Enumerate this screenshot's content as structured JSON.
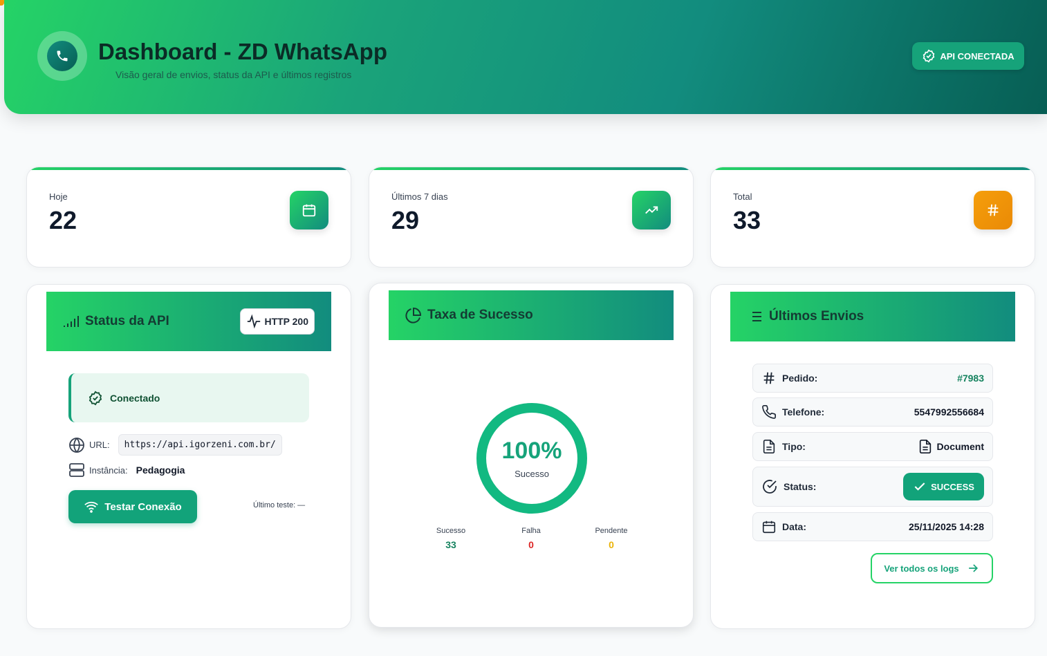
{
  "header": {
    "title": "Dashboard - ZD WhatsApp",
    "subtitle": "Visão geral de envios, status da API e últimos registros",
    "api_status_label": "API CONECTADA"
  },
  "stats": [
    {
      "label": "Hoje",
      "value": "22",
      "icon": "calendar-icon"
    },
    {
      "label": "Últimos 7 dias",
      "value": "29",
      "icon": "trending-up-icon"
    },
    {
      "label": "Total",
      "value": "33",
      "icon": "hash-icon"
    }
  ],
  "api_panel": {
    "title": "Status da API",
    "http_badge": "HTTP 200",
    "connection_status": "Conectado",
    "url_label": "URL:",
    "url_value": "https://api.igorzeni.com.br/",
    "instance_label": "Instância:",
    "instance_value": "Pedagogia",
    "test_button": "Testar Conexão",
    "last_test": "Último teste: —"
  },
  "success_panel": {
    "title": "Taxa de Sucesso",
    "percent_label": "100%",
    "percent_value": 100,
    "caption": "Sucesso",
    "legend": [
      {
        "label": "Sucesso",
        "value": "33",
        "color": "#16a37a"
      },
      {
        "label": "Falha",
        "value": "0",
        "color": "#dc2626"
      },
      {
        "label": "Pendente",
        "value": "0",
        "color": "#eab308"
      }
    ]
  },
  "last_sends": {
    "title": "Últimos Envios",
    "rows": [
      {
        "label": "Pedido:",
        "value": "#7983",
        "icon": "hash-icon"
      },
      {
        "label": "Telefone:",
        "value": "5547992556684",
        "icon": "phone-icon"
      },
      {
        "label": "Tipo:",
        "value": "Document",
        "icon": "document-icon"
      },
      {
        "label": "Status:",
        "value": "SUCCESS",
        "icon": "check-circle-icon"
      },
      {
        "label": "Data:",
        "value": "25/11/2025 14:28",
        "icon": "calendar-icon"
      }
    ],
    "logs_button": "Ver todos os logs"
  },
  "colors": {
    "brand_green": "#25d366",
    "brand_teal": "#128c7e",
    "accent": "#16a37a",
    "orange": "#f59e0b"
  }
}
